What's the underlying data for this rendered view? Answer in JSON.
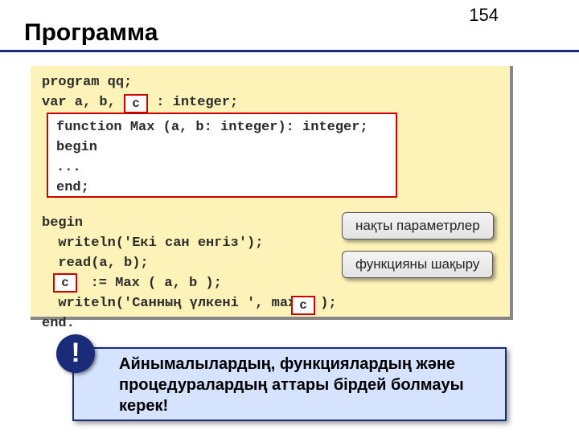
{
  "page_number": "154",
  "title": "Программа",
  "code": {
    "l1": "program qq;",
    "l2a": "var a, b, ",
    "l2b": " : integer;",
    "l3": "begin",
    "l4": "  writeln('Екі сан енгіз');",
    "l5": "  read(a, b);",
    "l6a": "  ",
    "l6b": " := Max ( a, b );",
    "l7a": "  writeln('Санның үлкені ', max",
    "l7b": ");",
    "l8": "end."
  },
  "inner_func": {
    "f1": "function Max (a, b: integer): integer;",
    "f2": "begin",
    "f3": "  ...",
    "f4": "end;"
  },
  "c_label": "c",
  "callouts": {
    "params": "нақты параметрлер",
    "call": "функцияны шақыру"
  },
  "warning": {
    "icon": "!",
    "text": "  Айнымалылардың, функциялардың және процедуралардың аттары бірдей болмауы керек!"
  }
}
